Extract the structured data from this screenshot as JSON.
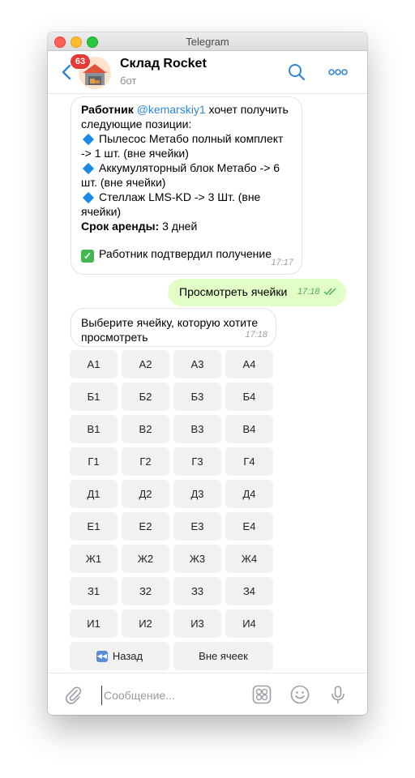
{
  "window": {
    "title": "Telegram"
  },
  "header": {
    "unread_badge": "63",
    "chat_name": "Склад Rocket",
    "chat_subtitle": "бот",
    "icons": [
      "back-chevron-icon",
      "search-icon",
      "more-icon"
    ]
  },
  "messages": {
    "request": {
      "worker_label": "Работник",
      "mention": "@kemarskiy1",
      "intro_suffix": " хочет получить",
      "intro_line2": "следующие позиции:",
      "item1_line1": "Пылесос Метабо полный комплект",
      "item1_line2": "-> 1 шт. (вне ячейки)",
      "item2_line1": "Аккумуляторный блок Метабо -> 6",
      "item2_line2": "шт. (вне ячейки)",
      "item3_line1": "Стеллаж LMS-KD -> 3 Шт. (вне",
      "item3_line2": "ячейки)",
      "rent_label": "Срок аренды:",
      "rent_value": " 3 дней",
      "confirmed": "Работник подтвердил получение",
      "time": "17:17"
    },
    "outgoing": {
      "text": "Просмотреть ячейки",
      "time": "17:18"
    },
    "prompt": {
      "line1": "Выберите ячейку, которую хотите",
      "line2": "просмотреть",
      "time": "17:18"
    }
  },
  "keyboard": {
    "cells": [
      "А1",
      "А2",
      "А3",
      "А4",
      "Б1",
      "Б2",
      "Б3",
      "Б4",
      "В1",
      "В2",
      "В3",
      "В4",
      "Г1",
      "Г2",
      "Г3",
      "Г4",
      "Д1",
      "Д2",
      "Д3",
      "Д4",
      "Е1",
      "Е2",
      "Е3",
      "Е4",
      "Ж1",
      "Ж2",
      "Ж3",
      "Ж4",
      "З1",
      "З2",
      "З3",
      "З4",
      "И1",
      "И2",
      "И3",
      "И4"
    ],
    "back_label": "Назад",
    "outside_label": "Вне ячеек"
  },
  "composer": {
    "placeholder": "Сообщение...",
    "icons": [
      "attach-icon",
      "sticker-icon",
      "emoji-icon",
      "microphone-icon"
    ]
  },
  "colors": {
    "accent": "#2f87d9",
    "outgoing_bubble": "#e1fec6",
    "badge": "#e53935"
  }
}
